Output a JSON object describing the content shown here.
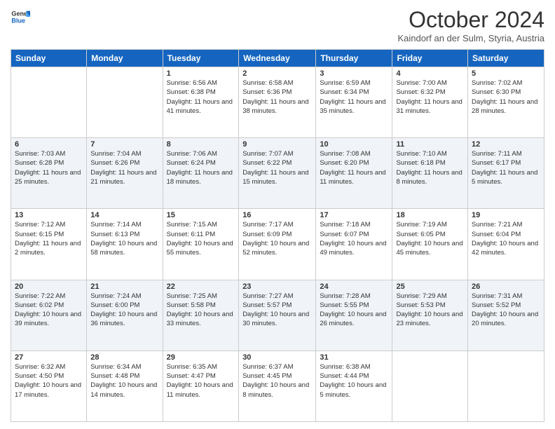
{
  "header": {
    "logo_line1": "General",
    "logo_line2": "Blue",
    "month_title": "October 2024",
    "location": "Kaindorf an der Sulm, Styria, Austria"
  },
  "days_of_week": [
    "Sunday",
    "Monday",
    "Tuesday",
    "Wednesday",
    "Thursday",
    "Friday",
    "Saturday"
  ],
  "weeks": [
    [
      {
        "day": "",
        "sunrise": "",
        "sunset": "",
        "daylight": ""
      },
      {
        "day": "",
        "sunrise": "",
        "sunset": "",
        "daylight": ""
      },
      {
        "day": "1",
        "sunrise": "Sunrise: 6:56 AM",
        "sunset": "Sunset: 6:38 PM",
        "daylight": "Daylight: 11 hours and 41 minutes."
      },
      {
        "day": "2",
        "sunrise": "Sunrise: 6:58 AM",
        "sunset": "Sunset: 6:36 PM",
        "daylight": "Daylight: 11 hours and 38 minutes."
      },
      {
        "day": "3",
        "sunrise": "Sunrise: 6:59 AM",
        "sunset": "Sunset: 6:34 PM",
        "daylight": "Daylight: 11 hours and 35 minutes."
      },
      {
        "day": "4",
        "sunrise": "Sunrise: 7:00 AM",
        "sunset": "Sunset: 6:32 PM",
        "daylight": "Daylight: 11 hours and 31 minutes."
      },
      {
        "day": "5",
        "sunrise": "Sunrise: 7:02 AM",
        "sunset": "Sunset: 6:30 PM",
        "daylight": "Daylight: 11 hours and 28 minutes."
      }
    ],
    [
      {
        "day": "6",
        "sunrise": "Sunrise: 7:03 AM",
        "sunset": "Sunset: 6:28 PM",
        "daylight": "Daylight: 11 hours and 25 minutes."
      },
      {
        "day": "7",
        "sunrise": "Sunrise: 7:04 AM",
        "sunset": "Sunset: 6:26 PM",
        "daylight": "Daylight: 11 hours and 21 minutes."
      },
      {
        "day": "8",
        "sunrise": "Sunrise: 7:06 AM",
        "sunset": "Sunset: 6:24 PM",
        "daylight": "Daylight: 11 hours and 18 minutes."
      },
      {
        "day": "9",
        "sunrise": "Sunrise: 7:07 AM",
        "sunset": "Sunset: 6:22 PM",
        "daylight": "Daylight: 11 hours and 15 minutes."
      },
      {
        "day": "10",
        "sunrise": "Sunrise: 7:08 AM",
        "sunset": "Sunset: 6:20 PM",
        "daylight": "Daylight: 11 hours and 11 minutes."
      },
      {
        "day": "11",
        "sunrise": "Sunrise: 7:10 AM",
        "sunset": "Sunset: 6:18 PM",
        "daylight": "Daylight: 11 hours and 8 minutes."
      },
      {
        "day": "12",
        "sunrise": "Sunrise: 7:11 AM",
        "sunset": "Sunset: 6:17 PM",
        "daylight": "Daylight: 11 hours and 5 minutes."
      }
    ],
    [
      {
        "day": "13",
        "sunrise": "Sunrise: 7:12 AM",
        "sunset": "Sunset: 6:15 PM",
        "daylight": "Daylight: 11 hours and 2 minutes."
      },
      {
        "day": "14",
        "sunrise": "Sunrise: 7:14 AM",
        "sunset": "Sunset: 6:13 PM",
        "daylight": "Daylight: 10 hours and 58 minutes."
      },
      {
        "day": "15",
        "sunrise": "Sunrise: 7:15 AM",
        "sunset": "Sunset: 6:11 PM",
        "daylight": "Daylight: 10 hours and 55 minutes."
      },
      {
        "day": "16",
        "sunrise": "Sunrise: 7:17 AM",
        "sunset": "Sunset: 6:09 PM",
        "daylight": "Daylight: 10 hours and 52 minutes."
      },
      {
        "day": "17",
        "sunrise": "Sunrise: 7:18 AM",
        "sunset": "Sunset: 6:07 PM",
        "daylight": "Daylight: 10 hours and 49 minutes."
      },
      {
        "day": "18",
        "sunrise": "Sunrise: 7:19 AM",
        "sunset": "Sunset: 6:05 PM",
        "daylight": "Daylight: 10 hours and 45 minutes."
      },
      {
        "day": "19",
        "sunrise": "Sunrise: 7:21 AM",
        "sunset": "Sunset: 6:04 PM",
        "daylight": "Daylight: 10 hours and 42 minutes."
      }
    ],
    [
      {
        "day": "20",
        "sunrise": "Sunrise: 7:22 AM",
        "sunset": "Sunset: 6:02 PM",
        "daylight": "Daylight: 10 hours and 39 minutes."
      },
      {
        "day": "21",
        "sunrise": "Sunrise: 7:24 AM",
        "sunset": "Sunset: 6:00 PM",
        "daylight": "Daylight: 10 hours and 36 minutes."
      },
      {
        "day": "22",
        "sunrise": "Sunrise: 7:25 AM",
        "sunset": "Sunset: 5:58 PM",
        "daylight": "Daylight: 10 hours and 33 minutes."
      },
      {
        "day": "23",
        "sunrise": "Sunrise: 7:27 AM",
        "sunset": "Sunset: 5:57 PM",
        "daylight": "Daylight: 10 hours and 30 minutes."
      },
      {
        "day": "24",
        "sunrise": "Sunrise: 7:28 AM",
        "sunset": "Sunset: 5:55 PM",
        "daylight": "Daylight: 10 hours and 26 minutes."
      },
      {
        "day": "25",
        "sunrise": "Sunrise: 7:29 AM",
        "sunset": "Sunset: 5:53 PM",
        "daylight": "Daylight: 10 hours and 23 minutes."
      },
      {
        "day": "26",
        "sunrise": "Sunrise: 7:31 AM",
        "sunset": "Sunset: 5:52 PM",
        "daylight": "Daylight: 10 hours and 20 minutes."
      }
    ],
    [
      {
        "day": "27",
        "sunrise": "Sunrise: 6:32 AM",
        "sunset": "Sunset: 4:50 PM",
        "daylight": "Daylight: 10 hours and 17 minutes."
      },
      {
        "day": "28",
        "sunrise": "Sunrise: 6:34 AM",
        "sunset": "Sunset: 4:48 PM",
        "daylight": "Daylight: 10 hours and 14 minutes."
      },
      {
        "day": "29",
        "sunrise": "Sunrise: 6:35 AM",
        "sunset": "Sunset: 4:47 PM",
        "daylight": "Daylight: 10 hours and 11 minutes."
      },
      {
        "day": "30",
        "sunrise": "Sunrise: 6:37 AM",
        "sunset": "Sunset: 4:45 PM",
        "daylight": "Daylight: 10 hours and 8 minutes."
      },
      {
        "day": "31",
        "sunrise": "Sunrise: 6:38 AM",
        "sunset": "Sunset: 4:44 PM",
        "daylight": "Daylight: 10 hours and 5 minutes."
      },
      {
        "day": "",
        "sunrise": "",
        "sunset": "",
        "daylight": ""
      },
      {
        "day": "",
        "sunrise": "",
        "sunset": "",
        "daylight": ""
      }
    ]
  ]
}
